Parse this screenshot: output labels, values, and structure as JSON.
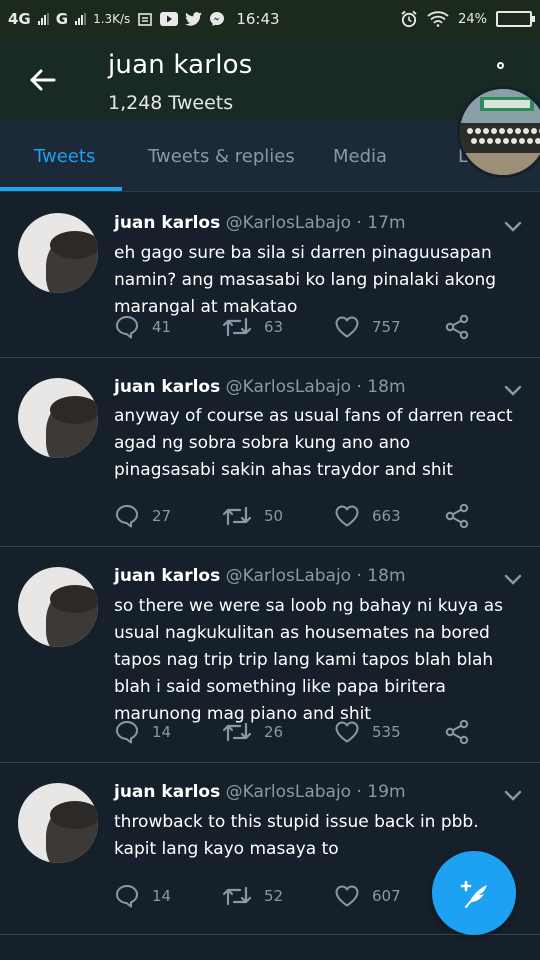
{
  "status_bar": {
    "network_1": "4G",
    "network_2": "G",
    "speed": "1.3K/s",
    "time": "16:43",
    "battery_text": "24%",
    "battery_level": 0.24
  },
  "header": {
    "title": "juan karlos",
    "subtitle": "1,248 Tweets"
  },
  "tabs": [
    {
      "label": "Tweets"
    },
    {
      "label": "Tweets & replies"
    },
    {
      "label": "Media"
    },
    {
      "label": "L"
    }
  ],
  "tweets": [
    {
      "name": "juan karlos",
      "handle": "@KarlosLabajo",
      "time": "· 17m",
      "text": "eh gago sure ba sila si darren pinaguusapan namin? ang masasabi ko lang pinalaki akong marangal at makatao",
      "replies": "41",
      "retweets": "63",
      "likes": "757"
    },
    {
      "name": "juan karlos",
      "handle": "@KarlosLabajo",
      "time": "· 18m",
      "text": "anyway of course as usual fans of darren react agad ng sobra sobra kung ano ano pinagsasabi sakin ahas traydor and shit",
      "replies": "27",
      "retweets": "50",
      "likes": "663"
    },
    {
      "name": "juan karlos",
      "handle": "@KarlosLabajo",
      "time": "· 18m",
      "text": "so there we were sa loob ng bahay ni kuya as usual nagkukulitan as housemates na bored tapos nag trip trip lang kami tapos blah blah blah i said something like papa biritera marunong mag piano and shit",
      "replies": "14",
      "retweets": "26",
      "likes": "535"
    },
    {
      "name": "juan karlos",
      "handle": "@KarlosLabajo",
      "time": "· 19m",
      "text": "throwback to this stupid issue back in pbb. kapit lang kayo masaya to",
      "replies": "14",
      "retweets": "52",
      "likes": "607"
    }
  ],
  "colors": {
    "background": "#15202b",
    "accent": "#1da1f2",
    "muted": "#8899a6"
  }
}
